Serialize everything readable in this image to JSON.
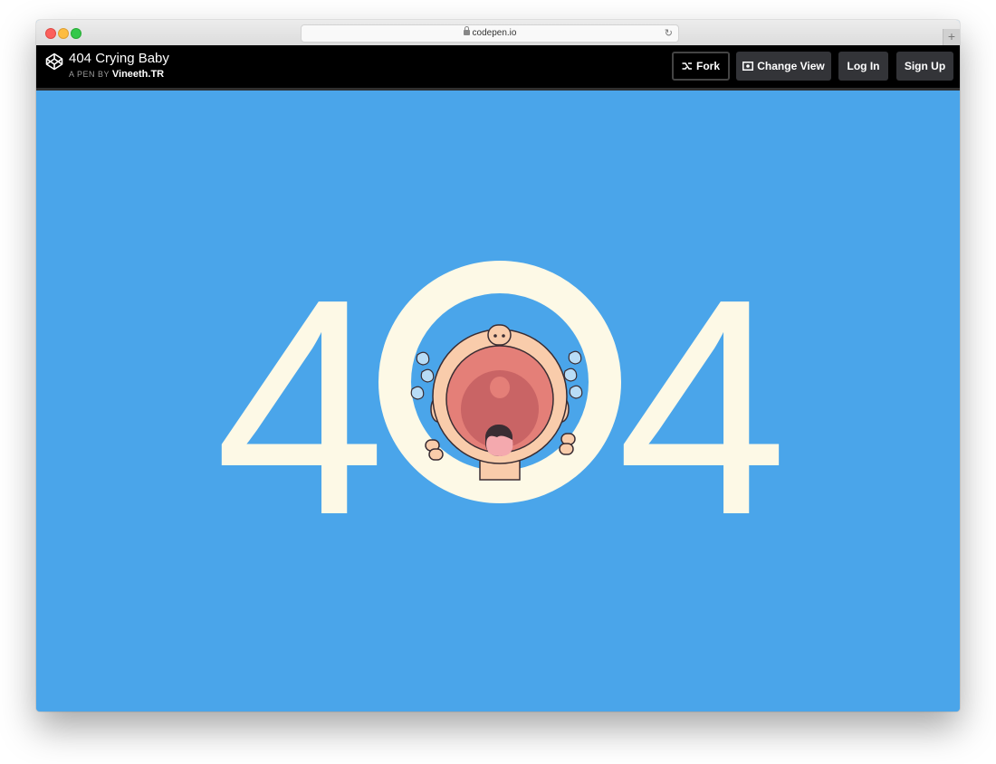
{
  "browser": {
    "url": "codepen.io",
    "reload_glyph": "↻",
    "newtab_glyph": "+"
  },
  "header": {
    "pen_title": "404 Crying Baby",
    "byline_prefix": "A PEN BY",
    "author": "Vineeth.TR",
    "buttons": {
      "fork": "Fork",
      "change_view": "Change View",
      "login": "Log In",
      "signup": "Sign Up"
    }
  },
  "main": {
    "digit_left": "4",
    "digit_right": "4",
    "zero_illustration": "crying-baby"
  },
  "colors": {
    "background": "#4aa5ea",
    "digit": "#fdf9e6",
    "header": "#000000",
    "button": "#333438"
  }
}
